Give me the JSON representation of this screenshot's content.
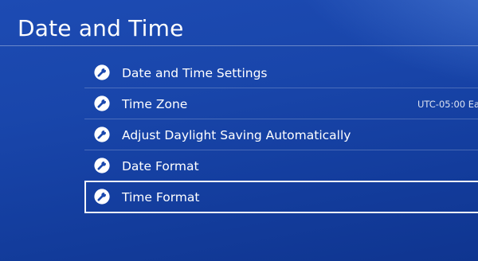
{
  "header": {
    "title": "Date and Time"
  },
  "menu": {
    "items": [
      {
        "label": "Date and Time Settings",
        "icon": "wrench-icon"
      },
      {
        "label": "Time Zone",
        "value": "UTC-05:00 Ea",
        "icon": "wrench-icon"
      },
      {
        "label": "Adjust Daylight Saving Automatically",
        "icon": "wrench-icon"
      },
      {
        "label": "Date Format",
        "icon": "wrench-icon"
      },
      {
        "label": "Time Format",
        "icon": "wrench-icon",
        "selected": true
      }
    ]
  },
  "colors": {
    "background": "#1946ab",
    "text": "#ffffff",
    "selection_border": "#ffffff"
  }
}
